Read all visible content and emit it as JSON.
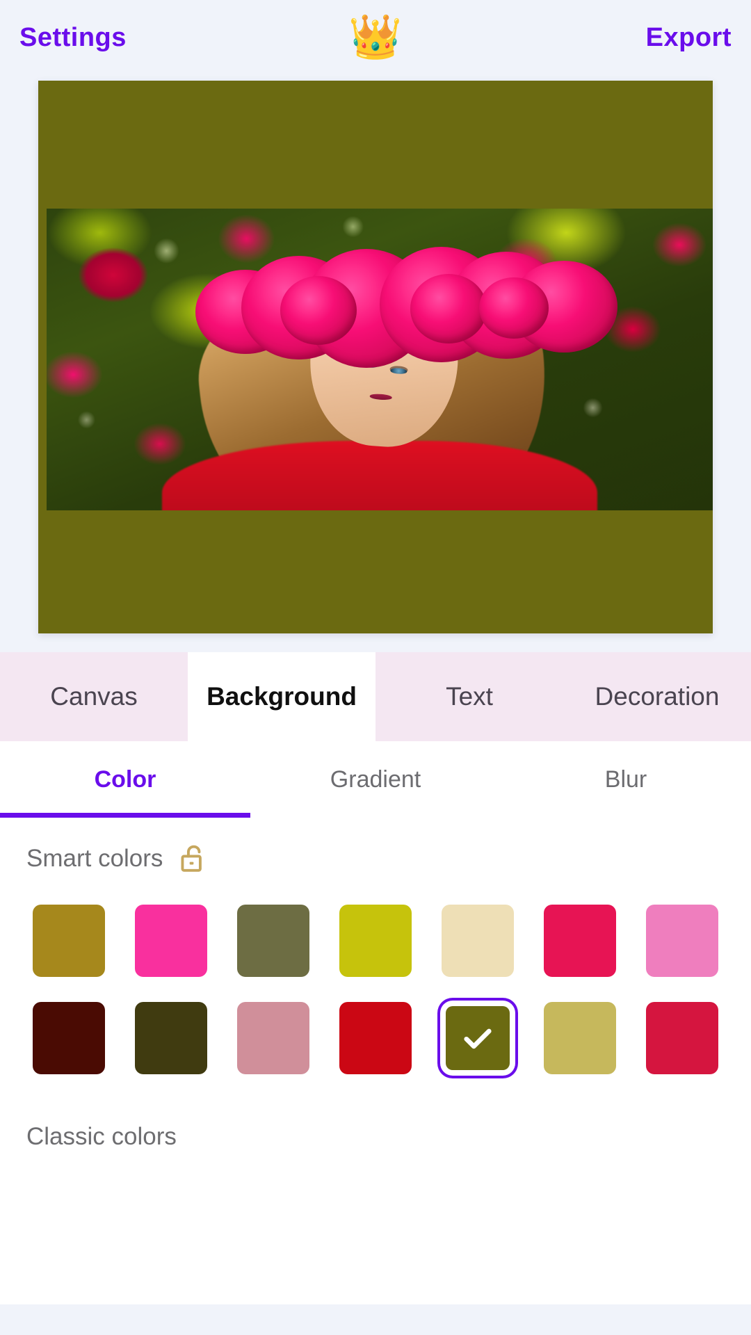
{
  "header": {
    "settings_label": "Settings",
    "logo_icon": "crown-icon",
    "logo_glyph": "👑",
    "export_label": "Export",
    "accent_color": "#6A0DEB"
  },
  "canvas": {
    "background_color": "#6B6A11",
    "photo_description": "Woman wearing a pink rose flower crown surrounded by red and pink roses"
  },
  "main_tabs": [
    {
      "label": "Canvas",
      "active": false
    },
    {
      "label": "Background",
      "active": true
    },
    {
      "label": "Text",
      "active": false
    },
    {
      "label": "Decoration",
      "active": false
    }
  ],
  "sub_tabs": [
    {
      "label": "Color",
      "active": true
    },
    {
      "label": "Gradient",
      "active": false
    },
    {
      "label": "Blur",
      "active": false
    }
  ],
  "smart_colors": {
    "title": "Smart colors",
    "lock_icon": "unlock-icon",
    "lock_color": "#C6A75E",
    "swatches": [
      {
        "hex": "#A6881C",
        "selected": false
      },
      {
        "hex": "#F9309E",
        "selected": false
      },
      {
        "hex": "#6D6D43",
        "selected": false
      },
      {
        "hex": "#C6C30C",
        "selected": false
      },
      {
        "hex": "#EEDFB6",
        "selected": false
      },
      {
        "hex": "#E71454",
        "selected": false
      },
      {
        "hex": "#EF7EBE",
        "selected": false
      },
      {
        "hex": "#4A0B03",
        "selected": false
      },
      {
        "hex": "#403B10",
        "selected": false
      },
      {
        "hex": "#D08F9A",
        "selected": false
      },
      {
        "hex": "#CB0714",
        "selected": false
      },
      {
        "hex": "#6B6A11",
        "selected": true
      },
      {
        "hex": "#C6B85C",
        "selected": false
      },
      {
        "hex": "#D5153F",
        "selected": false
      }
    ]
  },
  "classic_colors": {
    "title": "Classic colors"
  }
}
